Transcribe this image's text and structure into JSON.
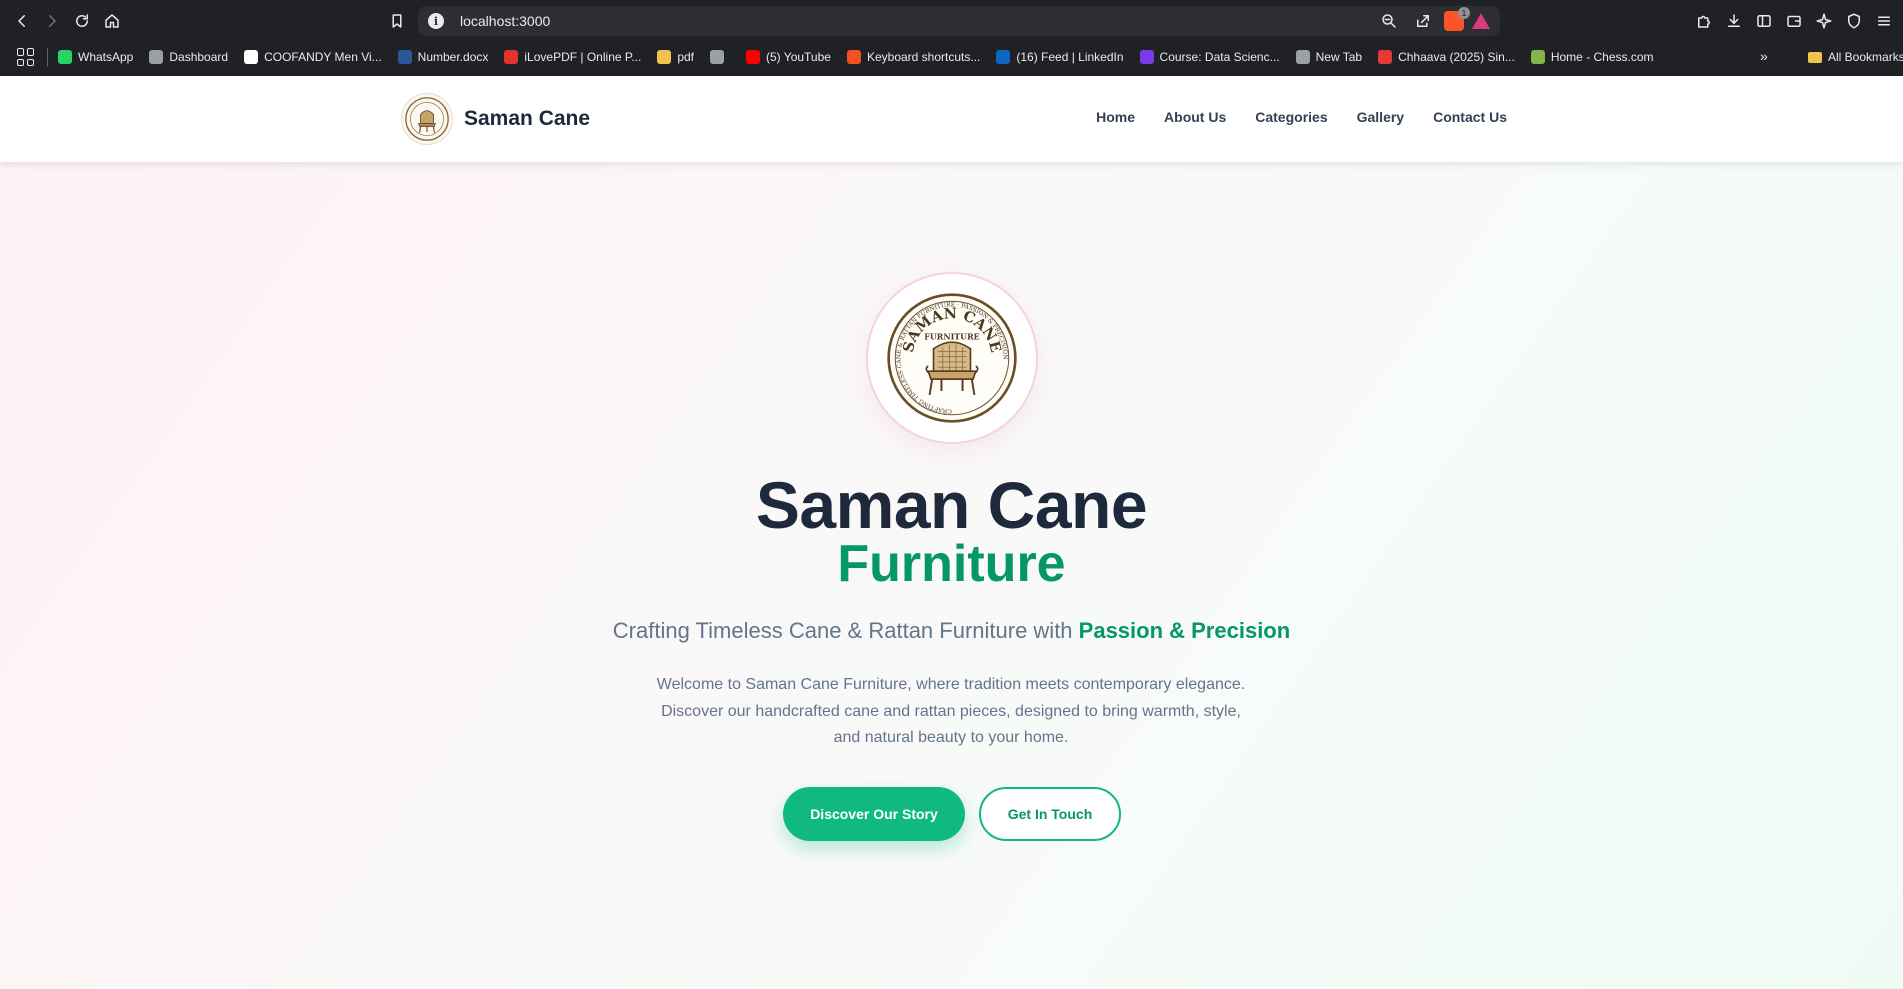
{
  "browser": {
    "url": "localhost:3000",
    "extension_badge": "1",
    "bookmarks": [
      {
        "label": "WhatsApp",
        "icon": "whatsapp-icon",
        "color": "#25d366"
      },
      {
        "label": "Dashboard",
        "icon": "dashboard-icon",
        "color": "#9aa0a6"
      },
      {
        "label": "COOFANDY Men Vi...",
        "icon": "amazon-icon",
        "color": "#ffffff"
      },
      {
        "label": "Number.docx",
        "icon": "word-icon",
        "color": "#2b579a"
      },
      {
        "label": "iLovePDF | Online P...",
        "icon": "ilovepdf-icon",
        "color": "#e5322d"
      },
      {
        "label": "pdf",
        "icon": "folder-icon",
        "color": "#f2c14e"
      },
      {
        "label": "",
        "icon": "globe-icon",
        "color": "#9aa0a6"
      },
      {
        "label": "(5) YouTube",
        "icon": "youtube-icon",
        "color": "#ff0000"
      },
      {
        "label": "Keyboard shortcuts...",
        "icon": "microsoft-icon",
        "color": "#f25022"
      },
      {
        "label": "(16) Feed | LinkedIn",
        "icon": "linkedin-icon",
        "color": "#0a66c2"
      },
      {
        "label": "Course: Data Scienc...",
        "icon": "course-icon",
        "color": "#7c3aed"
      },
      {
        "label": "New Tab",
        "icon": "globe-icon",
        "color": "#9aa0a6"
      },
      {
        "label": "Chhaava (2025) Sin...",
        "icon": "movie-icon",
        "color": "#e53935"
      },
      {
        "label": "Home - Chess.com",
        "icon": "chess-icon",
        "color": "#81b64c"
      }
    ],
    "bookmarks_more": "»",
    "all_bookmarks": "All Bookmarks"
  },
  "site": {
    "brand_name": "Saman Cane",
    "nav": [
      "Home",
      "About Us",
      "Categories",
      "Gallery",
      "Contact Us"
    ]
  },
  "hero": {
    "logo_text_top": "SAMAN CANE",
    "logo_text_mid": "FURNITURE",
    "logo_text_ring": "CRAFTING TIMELESS CANE & RATTAN FURNITURE · PASSION & PRECISION",
    "title": "Saman Cane",
    "subtitle": "Furniture",
    "tagline_plain": "Crafting Timeless Cane & Rattan Furniture with ",
    "tagline_accent": "Passion & Precision",
    "description": "Welcome to Saman Cane Furniture, where tradition meets contemporary elegance. Discover our handcrafted cane and rattan pieces, designed to bring warmth, style, and natural beauty to your home.",
    "primary_button": "Discover Our Story",
    "secondary_button": "Get In Touch"
  },
  "colors": {
    "accent_green": "#10b981",
    "dark_green": "#059669",
    "heading": "#1e293b",
    "body_text": "#64748b"
  }
}
